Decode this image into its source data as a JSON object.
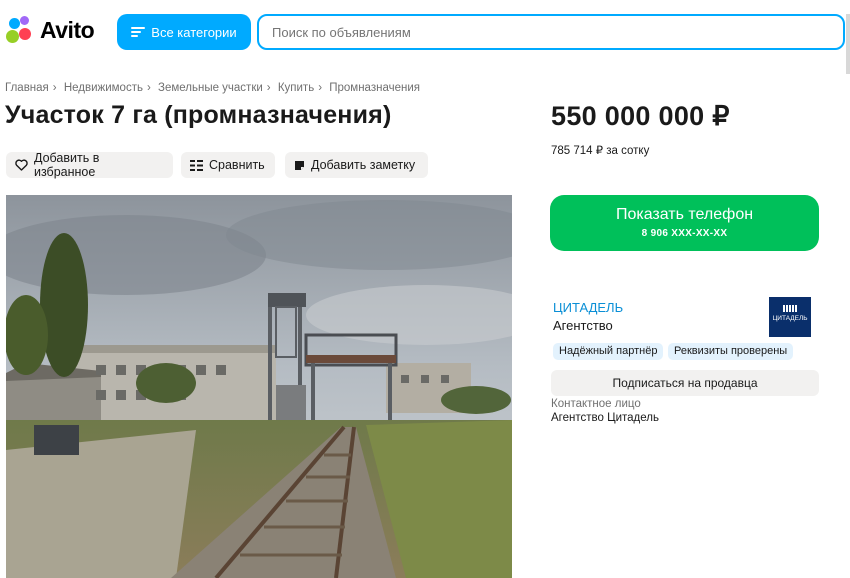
{
  "header": {
    "logo_text": "Avito",
    "categories_label": "Все категории",
    "search_placeholder": "Поиск по объявлениям"
  },
  "breadcrumbs": [
    "Главная",
    "Недвижимость",
    "Земельные участки",
    "Купить",
    "Промназначения"
  ],
  "listing": {
    "title": "Участок 7 га (промназначения)",
    "price": "550 000 000 ₽",
    "price_per_unit": "785 714 ₽ за сотку"
  },
  "actions": {
    "favorite": "Добавить в избранное",
    "compare": "Сравнить",
    "note": "Добавить заметку"
  },
  "contact": {
    "show_phone": "Показать телефон",
    "phone_masked": "8 906 XXX-XX-XX"
  },
  "seller": {
    "name": "ЦИТАДЕЛЬ",
    "type": "Агентство",
    "logo_text": "ЦИТАДЕЛЬ",
    "badges": [
      "Надёжный партнёр",
      "Реквизиты проверены"
    ],
    "subscribe_label": "Подписаться на продавца",
    "contact_person_label": "Контактное лицо",
    "contact_person_name": "Агентство Цитадель"
  },
  "colors": {
    "brand_blue": "#00aaff",
    "phone_green": "#00c05a",
    "seller_link": "#0a8fd6",
    "badge_bg": "#e3f2fd"
  }
}
